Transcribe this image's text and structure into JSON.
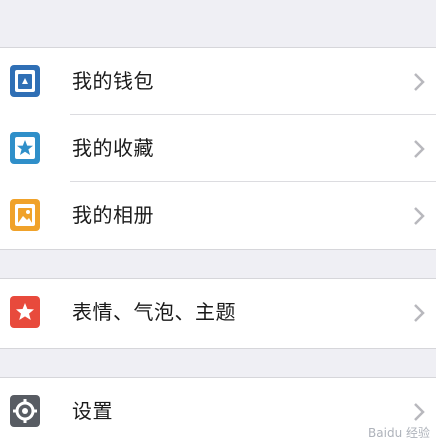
{
  "menu": {
    "items": [
      {
        "label": "我的钱包",
        "icon": "wallet-icon",
        "color": "#2f6fb5"
      },
      {
        "label": "我的收藏",
        "icon": "favorites-star-icon",
        "color": "#2f8fc9"
      },
      {
        "label": "我的相册",
        "icon": "photo-album-icon",
        "color": "#f0a22a"
      },
      {
        "label": "表情、气泡、主题",
        "icon": "emoji-bubble-theme-icon",
        "color": "#e84a3c"
      },
      {
        "label": "设置",
        "icon": "gear-icon",
        "color": "#585c63"
      }
    ]
  },
  "watermark": {
    "text": "Baidu 经验"
  },
  "colors": {
    "chevron": "#c4c4c8",
    "background": "#efeff4"
  }
}
